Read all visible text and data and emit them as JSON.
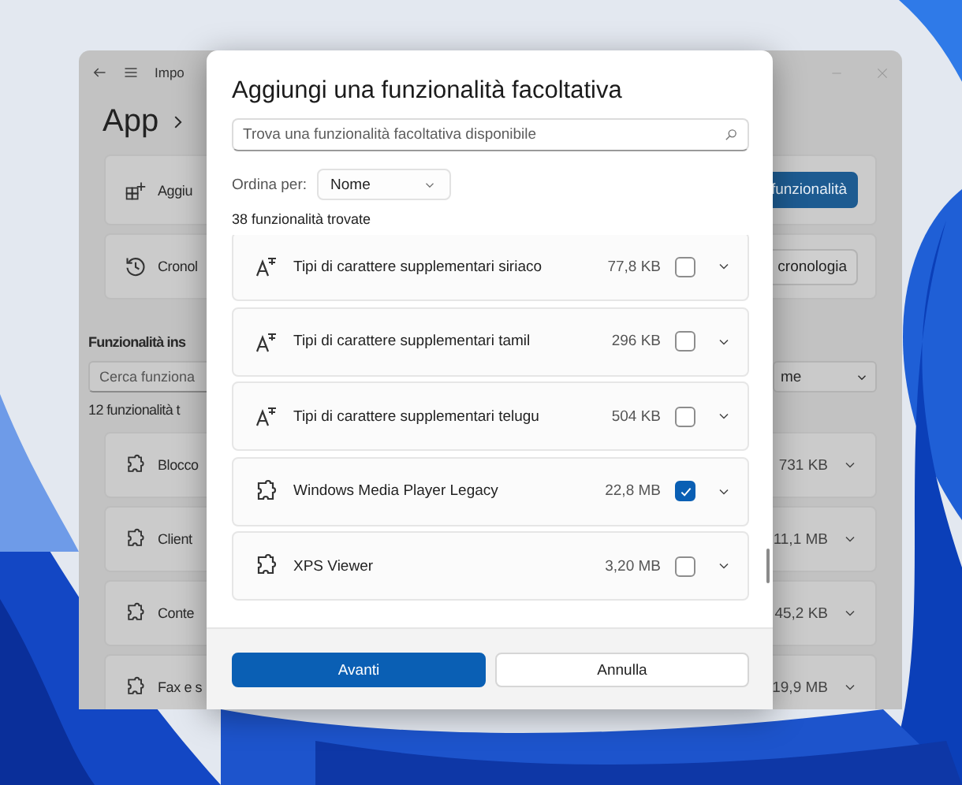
{
  "background_window": {
    "title": "Impo",
    "breadcrumb": "App",
    "actions": [
      {
        "kind": "add",
        "label": "Aggiu",
        "button": {
          "label": "funzionalità",
          "kind": "primary"
        }
      },
      {
        "kind": "history",
        "label": "Cronol",
        "button": {
          "label": "cronologia",
          "kind": "secondary"
        }
      }
    ],
    "section_title": "Funzionalità ins",
    "search": {
      "placeholder": "Cerca funziona"
    },
    "sort": {
      "value": "me"
    },
    "count": "12 funzionalità t",
    "features": [
      {
        "name": "Blocco",
        "size": "731 KB"
      },
      {
        "name": "Client",
        "size": "11,1 MB"
      },
      {
        "name": "Conte",
        "size": "45,2 KB"
      },
      {
        "name": "Fax e s",
        "size": "19,9 MB"
      }
    ]
  },
  "dialog": {
    "title": "Aggiungi una funzionalità facoltativa",
    "search": {
      "placeholder": "Trova una funzionalità facoltativa disponibile"
    },
    "sort": {
      "label": "Ordina per:",
      "value": "Nome"
    },
    "count": "38 funzionalità trovate",
    "features": [
      {
        "kind": "font",
        "name": "Tipi di carattere supplementari siriaco",
        "size": "77,8 KB",
        "checked": false
      },
      {
        "kind": "font",
        "name": "Tipi di carattere supplementari tamil",
        "size": "296 KB",
        "checked": false
      },
      {
        "kind": "font",
        "name": "Tipi di carattere supplementari telugu",
        "size": "504 KB",
        "checked": false
      },
      {
        "kind": "package",
        "name": "Windows Media Player Legacy",
        "size": "22,8 MB",
        "checked": true
      },
      {
        "kind": "package",
        "name": "XPS Viewer",
        "size": "3,20 MB",
        "checked": false
      }
    ],
    "buttons": [
      {
        "label": "Avanti",
        "kind": "primary"
      },
      {
        "label": "Annulla",
        "kind": "secondary"
      }
    ]
  }
}
